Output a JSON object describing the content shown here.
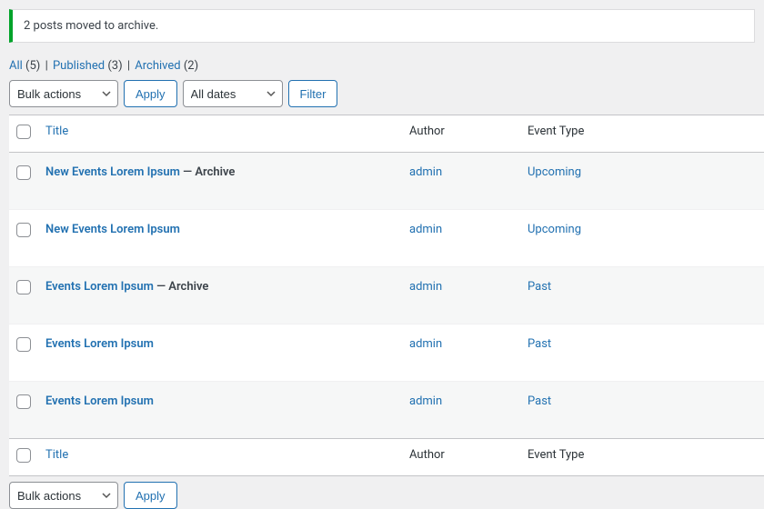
{
  "notice": {
    "message": "2 posts moved to archive."
  },
  "views": {
    "all_label": "All",
    "all_count": "(5)",
    "published_label": "Published",
    "published_count": "(3)",
    "archived_label": "Archived",
    "archived_count": "(2)"
  },
  "nav": {
    "bulk_actions": "Bulk actions",
    "apply": "Apply",
    "all_dates": "All dates",
    "filter": "Filter"
  },
  "columns": {
    "title": "Title",
    "author": "Author",
    "event_type": "Event Type"
  },
  "rows": [
    {
      "title": "New Events Lorem Ipsum",
      "state": " — Archive",
      "author": "admin",
      "event_type": "Upcoming"
    },
    {
      "title": "New Events Lorem Ipsum",
      "state": "",
      "author": "admin",
      "event_type": "Upcoming"
    },
    {
      "title": "Events Lorem Ipsum",
      "state": " — Archive",
      "author": "admin",
      "event_type": "Past"
    },
    {
      "title": "Events Lorem Ipsum",
      "state": "",
      "author": "admin",
      "event_type": "Past"
    },
    {
      "title": "Events Lorem Ipsum",
      "state": "",
      "author": "admin",
      "event_type": "Past"
    }
  ]
}
